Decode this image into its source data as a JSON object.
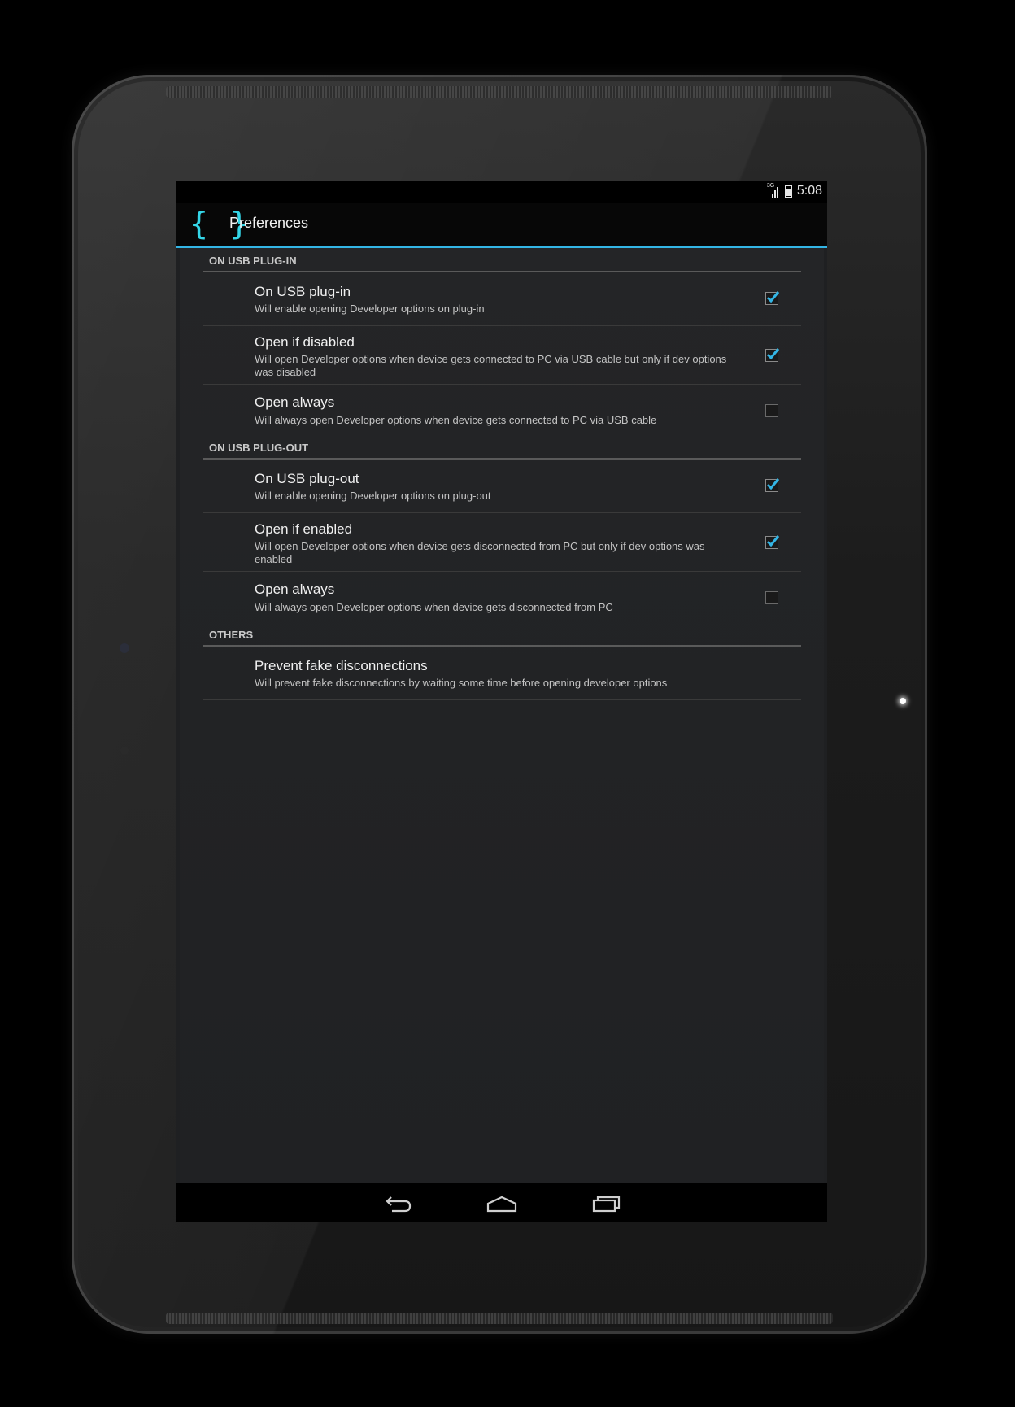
{
  "status_bar": {
    "network_badge": "3G",
    "time": "5:08"
  },
  "action_bar": {
    "icon_glyph": "{ }",
    "title": "Preferences"
  },
  "sections": [
    {
      "header": "ON USB PLUG-IN",
      "items": [
        {
          "title": "On USB plug-in",
          "summary": "Will enable opening Developer options on plug-in",
          "checked": true
        },
        {
          "title": "Open if disabled",
          "summary": "Will open Developer options when device gets connected to PC via USB cable but only if dev options was disabled",
          "checked": true
        },
        {
          "title": "Open always",
          "summary": "Will always open Developer options when device gets connected to PC via USB cable",
          "checked": false
        }
      ]
    },
    {
      "header": "ON USB PLUG-OUT",
      "items": [
        {
          "title": "On USB plug-out",
          "summary": "Will enable opening Developer options on plug-out",
          "checked": true
        },
        {
          "title": "Open if enabled",
          "summary": "Will open Developer options when device gets disconnected from PC but only if dev options was enabled",
          "checked": true
        },
        {
          "title": "Open always",
          "summary": "Will always open Developer options when device gets disconnected from PC",
          "checked": false
        }
      ]
    },
    {
      "header": "OTHERS",
      "items": [
        {
          "title": "Prevent fake disconnections",
          "summary": "Will prevent fake disconnections by waiting some time before opening developer options"
        }
      ]
    }
  ],
  "nav_bar": {
    "icons": [
      "back-icon",
      "home-icon",
      "recent-apps-icon"
    ]
  },
  "colors": {
    "accent": "#33b5e5",
    "app_icon": "#34d6e8",
    "background": "#1f2022"
  }
}
